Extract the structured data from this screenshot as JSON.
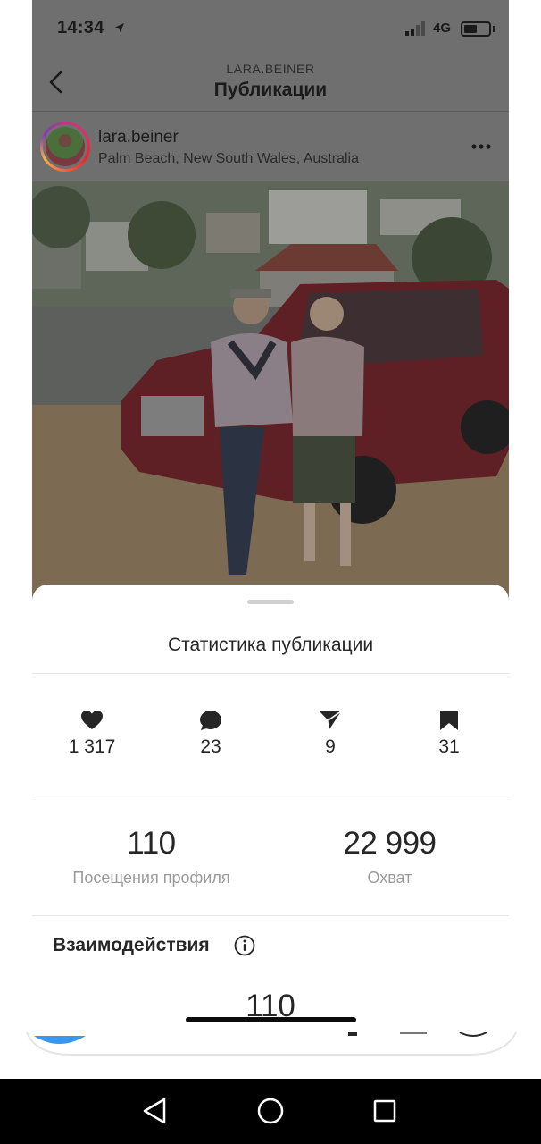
{
  "status_bar": {
    "time": "14:34",
    "network": "4G"
  },
  "header": {
    "username_caps": "LARA.BEINER",
    "title": "Публикации"
  },
  "post": {
    "username": "lara.beiner",
    "location": "Palm Beach, New South Wales, Australia"
  },
  "sheet": {
    "title": "Статистика публикации",
    "metrics": [
      {
        "icon": "heart-icon",
        "value": "1 317"
      },
      {
        "icon": "comment-icon",
        "value": "23"
      },
      {
        "icon": "send-icon",
        "value": "9"
      },
      {
        "icon": "bookmark-icon",
        "value": "31"
      }
    ],
    "profile_visits": {
      "value": "110",
      "label": "Посещения профиля"
    },
    "reach": {
      "value": "22 999",
      "label": "Охват"
    },
    "interactions_title": "Взаимодействия",
    "interactions_value": "110"
  },
  "colors": {
    "dim_overlay": "#6f6f6f",
    "accent_blue": "#3897f0"
  }
}
